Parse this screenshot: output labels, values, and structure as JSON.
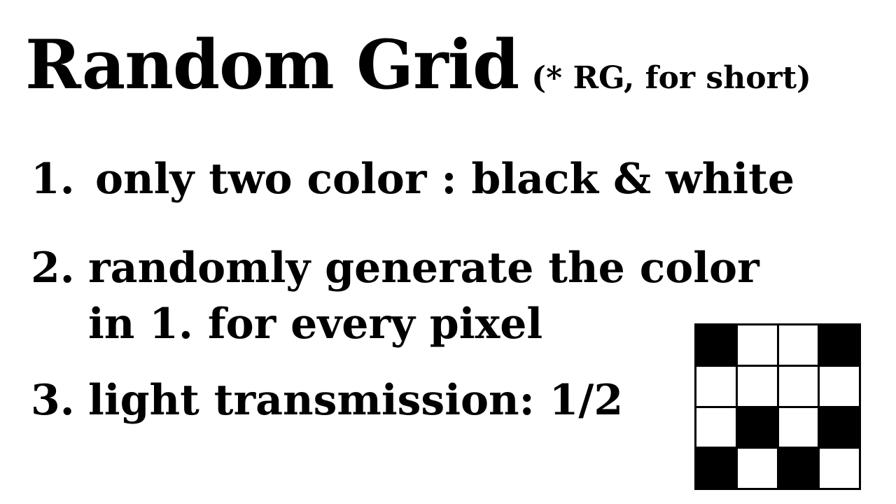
{
  "title": {
    "main": "Random Grid",
    "note": "(* RG, for short)"
  },
  "items": [
    {
      "number": "1.",
      "lines": [
        "only two color : black & white"
      ]
    },
    {
      "number": "2.",
      "lines": [
        "randomly generate the color",
        "in 1. for every pixel"
      ]
    },
    {
      "number": "3.",
      "lines": [
        "light transmission: 1/2"
      ]
    }
  ],
  "random_grid": {
    "rows": 4,
    "cols": 4,
    "cells": [
      [
        1,
        0,
        0,
        1
      ],
      [
        0,
        0,
        0,
        0
      ],
      [
        0,
        1,
        0,
        1
      ],
      [
        1,
        0,
        1,
        0
      ]
    ],
    "colors": {
      "black": "#000000",
      "white": "#ffffff"
    }
  }
}
